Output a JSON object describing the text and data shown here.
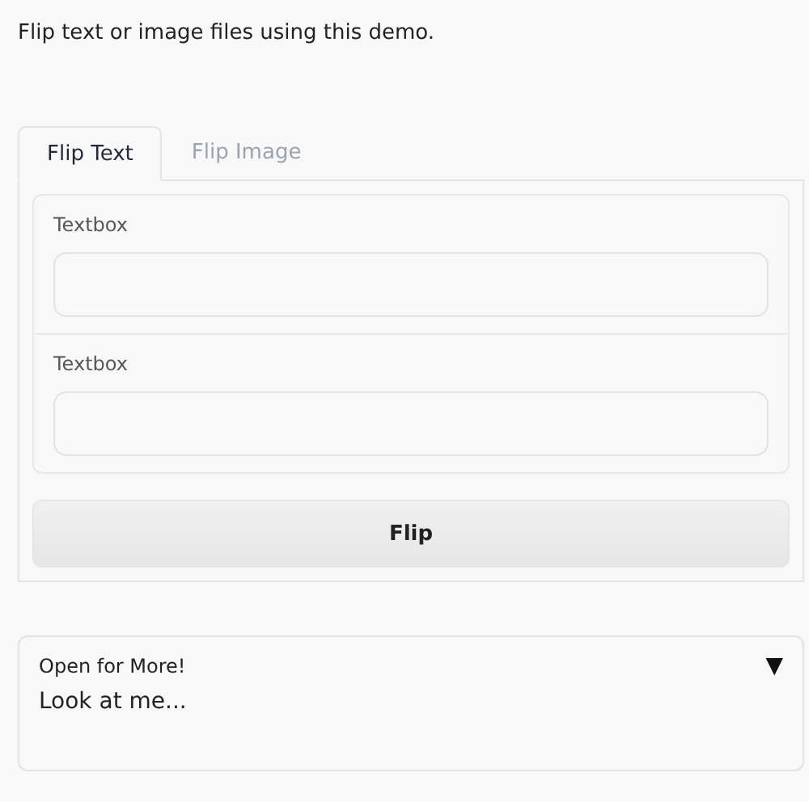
{
  "intro": "Flip text or image files using this demo.",
  "tabs": [
    {
      "label": "Flip Text",
      "selected": true
    },
    {
      "label": "Flip Image",
      "selected": false
    }
  ],
  "fields": [
    {
      "label": "Textbox"
    },
    {
      "label": "Textbox"
    }
  ],
  "button": "Flip",
  "accordion": {
    "title": "Open for More!",
    "arrow": "▼",
    "open": true,
    "content": "Look at me..."
  }
}
